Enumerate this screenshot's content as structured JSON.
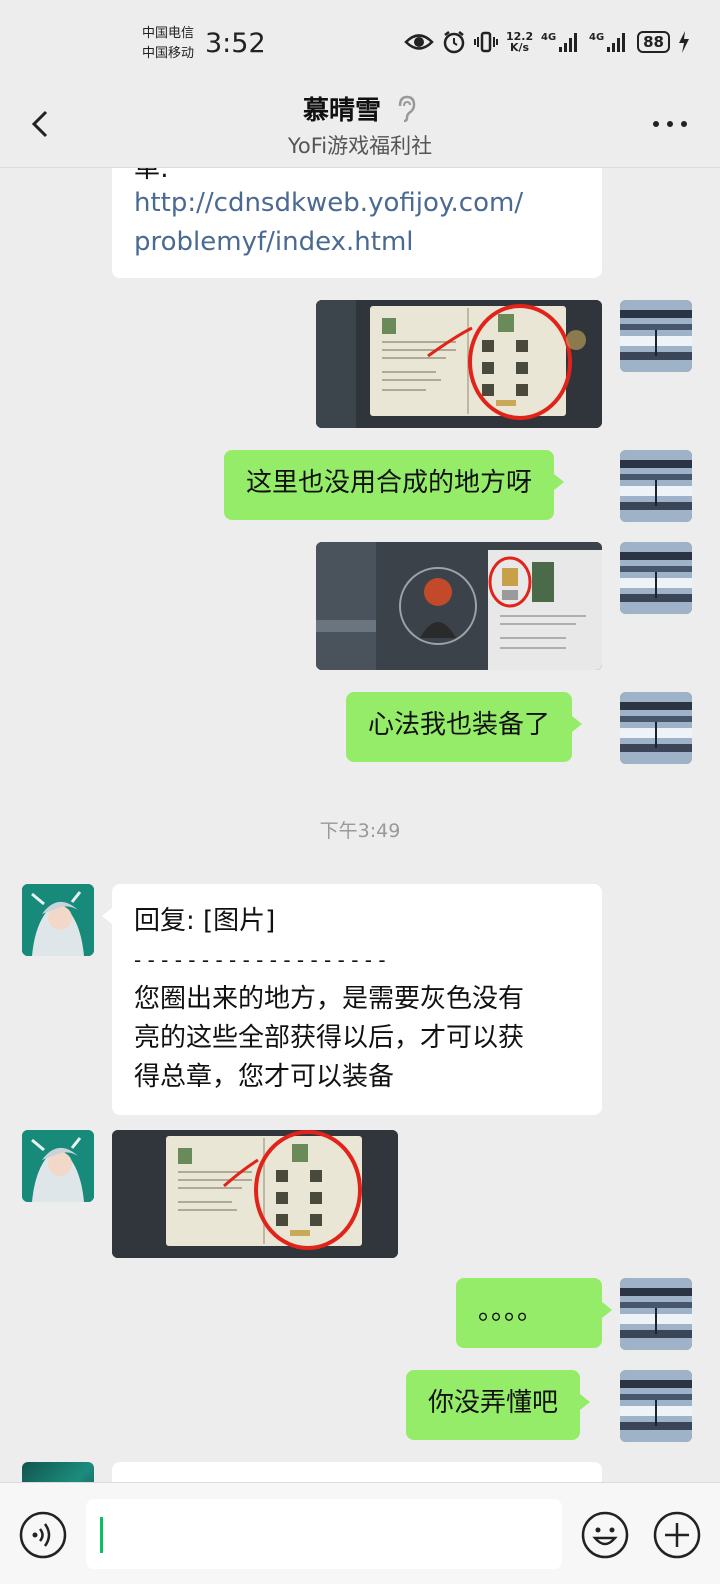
{
  "status": {
    "carrier1": "中国电信",
    "carrier2": "中国移动",
    "time": "3:52",
    "speed_top": "12.2",
    "speed_bottom": "K/s",
    "net1": "4G",
    "net2": "4G",
    "battery": "88"
  },
  "header": {
    "title": "慕晴雪",
    "subtitle": "YoFi游戏福利社"
  },
  "messages": {
    "m1_partial": "单:",
    "m1_link1": "http://cdnsdkweb.yofijoy.com/",
    "m1_link2": "problemyf/index.html",
    "m2": "这里也没用合成的地方呀",
    "m3": "心法我也装备了",
    "time_divider": "下午3:49",
    "m4_reply": "回复: [图片]",
    "m4_dash": "- - - - - - - - - - - - - - - - - - -",
    "m4_line1": "您圈出来的地方，是需要灰色没有",
    "m4_line2": "亮的这些全部获得以后，才可以获",
    "m4_line3": "得总章，您才可以装备",
    "m5": "。。。。",
    "m6": "你没弄懂吧"
  },
  "colors": {
    "bg": "#ededed",
    "bubble_self": "#95ec69",
    "bubble_other": "#ffffff",
    "link": "#4a6a92",
    "caret": "#07c160"
  }
}
